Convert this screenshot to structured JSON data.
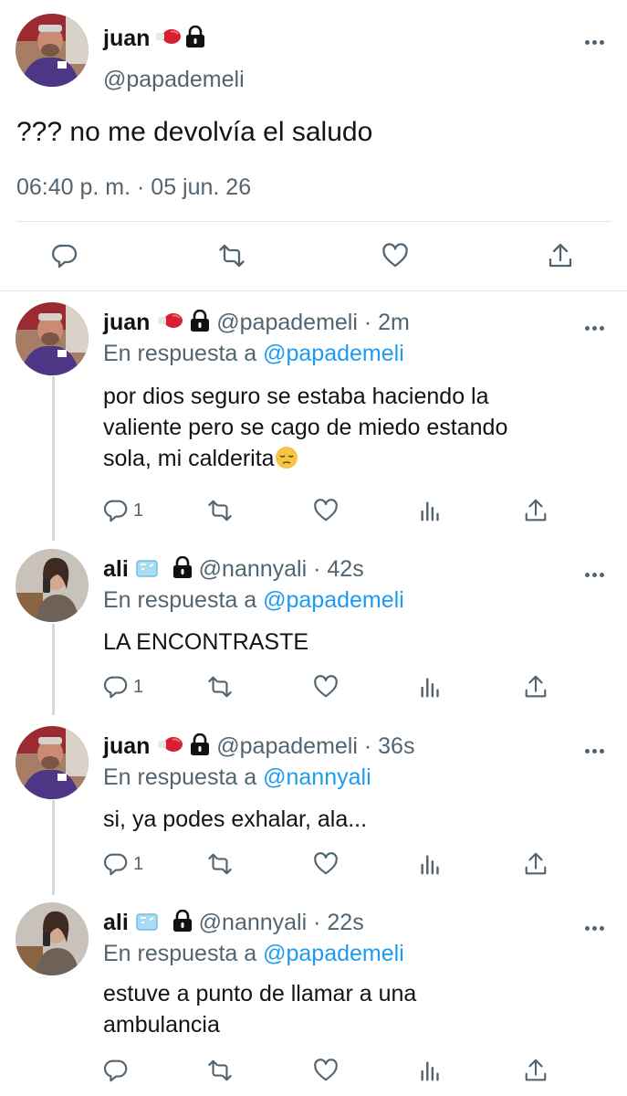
{
  "main_tweet": {
    "name": "juan",
    "handle": "@papademeli",
    "text": "??? no me devolvía el saludo",
    "timestamp": "06:40 p. m. · 05 jun. 26"
  },
  "replies": [
    {
      "name": "juan",
      "handle": "@papademeli",
      "time": "· 2m",
      "reply_label": "En respuesta a",
      "reply_to": "@papademeli",
      "text_line1": "por dios seguro se estaba haciendo la",
      "text_line2": "valiente pero se cago de miedo estando",
      "text_line3": "sola, mi calderita",
      "reply_count": "1"
    },
    {
      "name": "ali",
      "handle": "@nannyali",
      "time": "· 42s",
      "reply_label": "En respuesta a",
      "reply_to": "@papademeli",
      "text_line1": "LA ENCONTRASTE",
      "reply_count": "1"
    },
    {
      "name": "juan",
      "handle": "@papademeli",
      "time": "· 36s",
      "reply_label": "En respuesta a",
      "reply_to": "@nannyali",
      "text_line1": "si, ya podes exhalar, ala...",
      "reply_count": "1"
    },
    {
      "name": "ali",
      "handle": "@nannyali",
      "time": "· 22s",
      "reply_label": "En respuesta a",
      "reply_to": "@papademeli",
      "text_line1": "estuve a punto de llamar a una",
      "text_line2": "ambulancia"
    }
  ],
  "colors": {
    "link": "#1d9bf0",
    "muted": "#536471",
    "text": "#0f1419",
    "divider": "#e1e6ea"
  },
  "icons": [
    "more-icon",
    "lock-icon",
    "boxing-glove-icon",
    "ice-cube-icon",
    "reply-icon",
    "retweet-icon",
    "like-icon",
    "share-icon",
    "views-icon",
    "pensive-emoji-icon"
  ]
}
